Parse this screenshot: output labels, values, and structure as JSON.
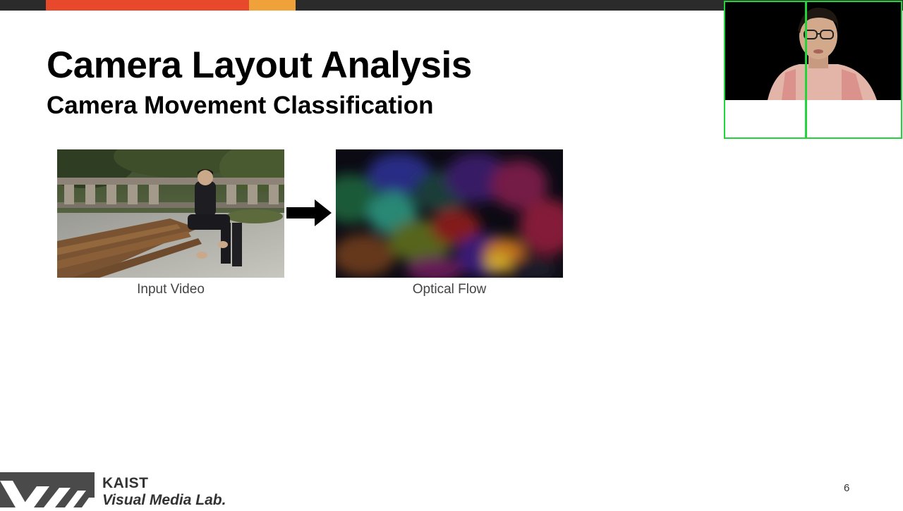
{
  "slide": {
    "title": "Camera Layout Analysis",
    "subtitle": "Camera Movement Classification",
    "page_number": "6"
  },
  "figures": {
    "input_caption": "Input Video",
    "flow_caption": "Optical Flow"
  },
  "footer": {
    "org_name": "KAIST",
    "lab_name": "Visual Media Lab."
  },
  "colors": {
    "top_bar": "#2b2b2b",
    "accent_red": "#e8482b",
    "accent_orange": "#f0a23a",
    "webcam_border": "#22d33a"
  },
  "icons": {
    "arrow": "arrow-right-icon",
    "logo": "vml-logo"
  }
}
